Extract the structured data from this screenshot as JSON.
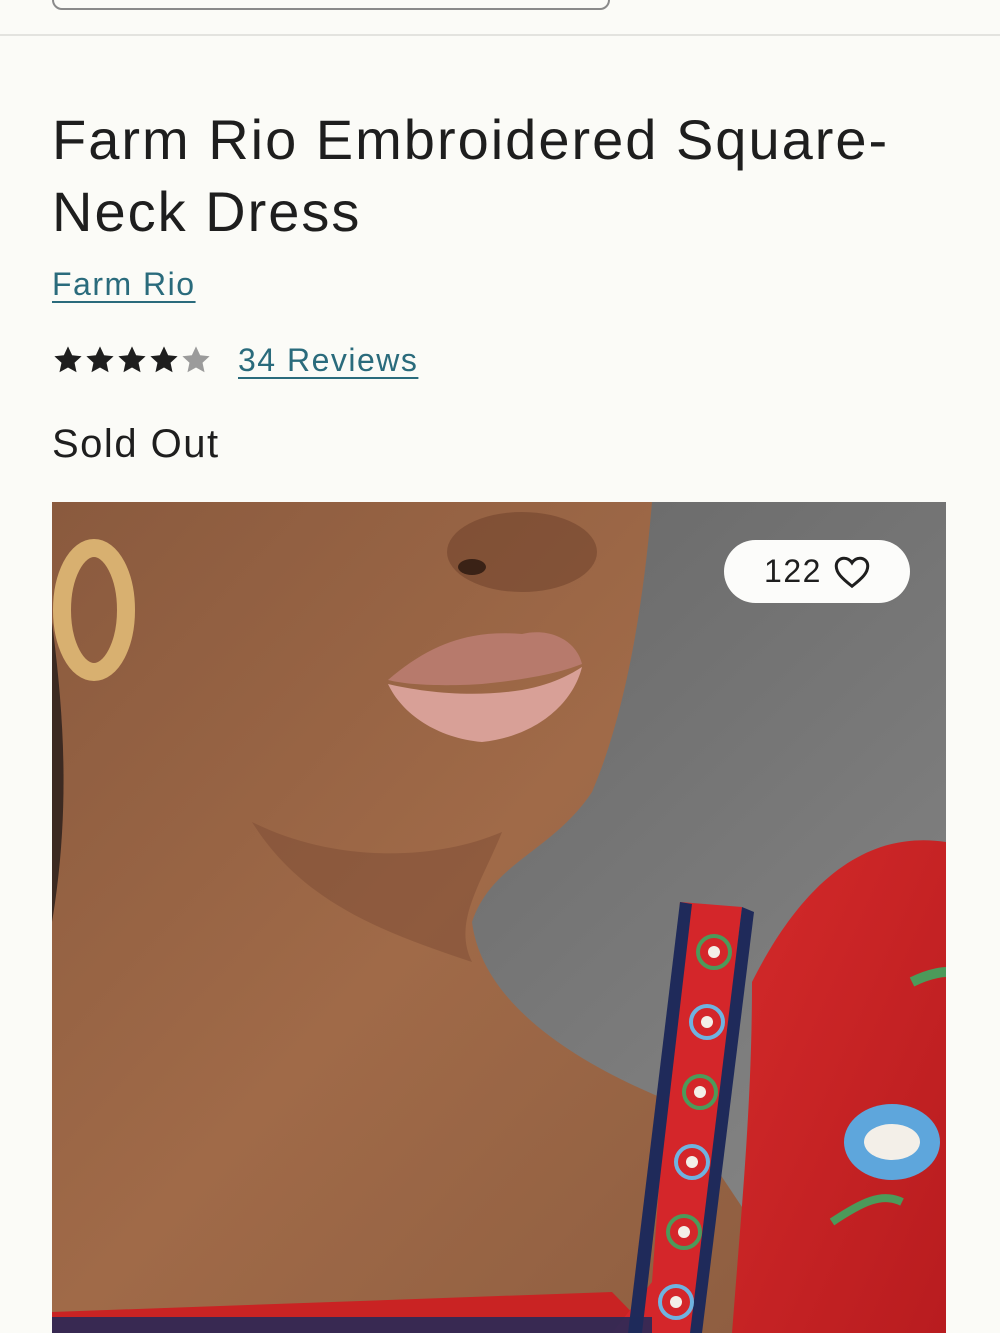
{
  "product": {
    "title": "Farm Rio Embroidered Square-Neck Dress",
    "brand": "Farm Rio",
    "rating": {
      "filled_stars": 4,
      "total_stars": 5,
      "reviews_label": "34 Reviews"
    },
    "stock_status": "Sold Out"
  },
  "gallery": {
    "favorite_count": "122",
    "favorite_icon": "heart-outline-icon"
  },
  "colors": {
    "link": "#2a6b7c",
    "text": "#1e1e1e",
    "background": "#fbfbf7",
    "star_filled": "#1e1e1e",
    "star_empty": "#9b9b9b"
  }
}
